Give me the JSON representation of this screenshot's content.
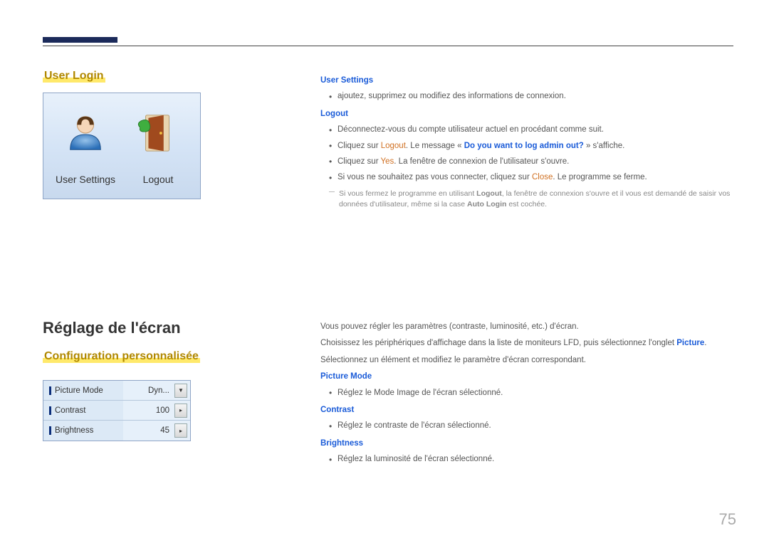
{
  "section1": {
    "heading": "User Login",
    "panel": {
      "userSettingsLabel": "User Settings",
      "logoutLabel": "Logout"
    }
  },
  "right1": {
    "userSettingsHead": "User Settings",
    "userSettingsBullet": "ajoutez, supprimez ou modifiez des informations de connexion.",
    "logoutHead": "Logout",
    "logoutB1": "Déconnectez-vous du compte utilisateur actuel en procédant comme suit.",
    "logoutB2_pre": "Cliquez sur ",
    "logoutB2_bold": "Logout",
    "logoutB2_mid": ". Le message « ",
    "logoutB2_msg": "Do you want to log admin out?",
    "logoutB2_post": " » s'affiche.",
    "logoutB3_pre": "Cliquez sur ",
    "logoutB3_yes": "Yes",
    "logoutB3_post": ". La fenêtre de connexion de l'utilisateur s'ouvre.",
    "logoutB4_pre": "Si vous ne souhaitez pas vous connecter, cliquez sur ",
    "logoutB4_close": "Close",
    "logoutB4_post": ". Le programme se ferme.",
    "note_pre": "Si vous fermez le programme en utilisant ",
    "note_logout": "Logout",
    "note_mid": ", la fenêtre de connexion s'ouvre et il vous est demandé de saisir vos données d'utilisateur, même si la case ",
    "note_auto": "Auto Login",
    "note_post": " est cochée."
  },
  "section2": {
    "title": "Réglage de l'écran",
    "subhead": "Configuration personnalisée",
    "rows": [
      {
        "label": "Picture Mode",
        "value": "Dyn...",
        "type": "dropdown"
      },
      {
        "label": "Contrast",
        "value": "100",
        "type": "arrow"
      },
      {
        "label": "Brightness",
        "value": "45",
        "type": "arrow"
      }
    ]
  },
  "right2": {
    "intro1": "Vous pouvez régler les paramètres (contraste, luminosité, etc.) d'écran.",
    "intro2_pre": "Choisissez les périphériques d'affichage dans la liste de moniteurs LFD, puis sélectionnez l'onglet ",
    "intro2_picture": "Picture",
    "intro2_post": ".",
    "intro3": "Sélectionnez un élément et modifiez le paramètre d'écran correspondant.",
    "pm_head": "Picture Mode",
    "pm_b": "Réglez le Mode Image de l'écran sélectionné.",
    "ct_head": "Contrast",
    "ct_b": "Réglez le contraste de l'écran sélectionné.",
    "br_head": "Brightness",
    "br_b": "Réglez la luminosité de l'écran sélectionné."
  },
  "pageNumber": "75"
}
